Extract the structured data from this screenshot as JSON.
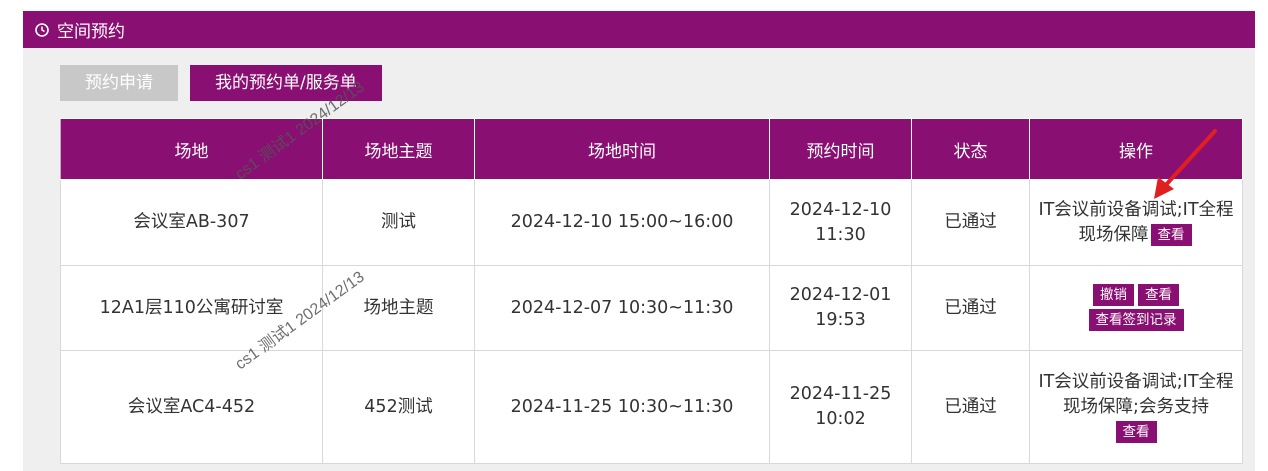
{
  "header": {
    "title": "空间预约"
  },
  "tabs": [
    {
      "label": "预约申请",
      "active": false
    },
    {
      "label": "我的预约单/服务单",
      "active": true
    }
  ],
  "table": {
    "headers": [
      "场地",
      "场地主题",
      "场地时间",
      "预约时间",
      "状态",
      "操作"
    ],
    "rows": [
      {
        "venue": "会议室AB-307",
        "topic": "测试",
        "venue_time": "2024-12-10 15:00~16:00",
        "booking_date": "2024-12-10",
        "booking_time": "11:30",
        "status": "已通过",
        "service_text": "IT会议前设备调试;IT全程现场保障",
        "buttons": [
          "查看"
        ]
      },
      {
        "venue": "12A1层110公寓研讨室",
        "topic": "场地主题",
        "venue_time": "2024-12-07 10:30~11:30",
        "booking_date": "2024-12-01",
        "booking_time": "19:53",
        "status": "已通过",
        "buttons": [
          "撤销",
          "查看",
          "查看签到记录"
        ]
      },
      {
        "venue": "会议室AC4-452",
        "topic": "452测试",
        "venue_time": "2024-11-25 10:30~11:30",
        "booking_date": "2024-11-25",
        "booking_time": "10:02",
        "status": "已通过",
        "service_text": "IT会议前设备调试;IT全程现场保障;会务支持",
        "buttons": [
          "查看"
        ]
      }
    ]
  },
  "watermark": {
    "text": "cs1 测试1 2024/12/13"
  },
  "colors": {
    "brand": "#8a0f72",
    "inactive_tab": "#c8c8c8",
    "panel_bg": "#efefef",
    "arrow": "#e02020"
  }
}
